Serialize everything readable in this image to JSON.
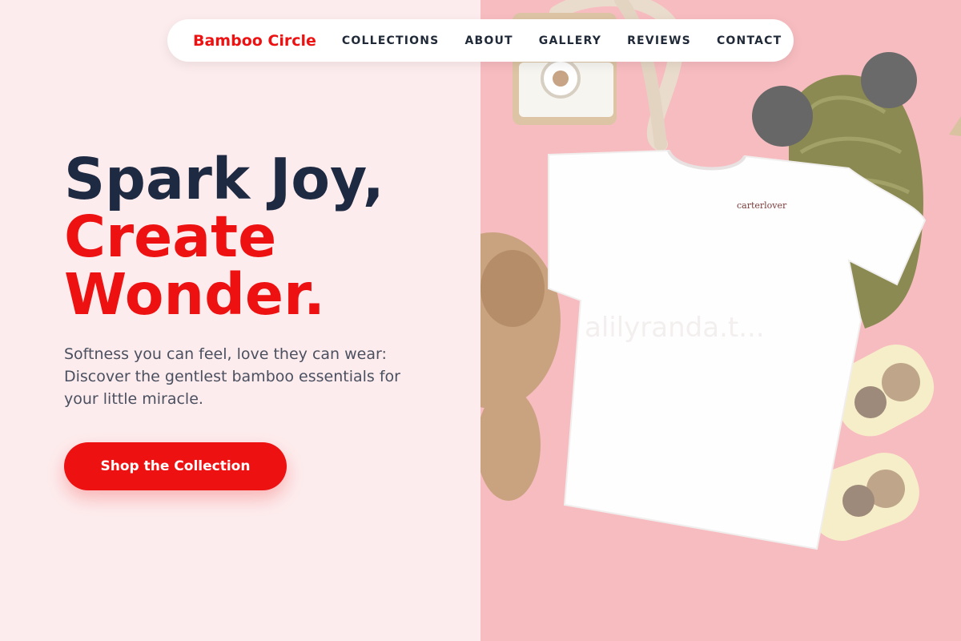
{
  "nav": {
    "brand": "Bamboo Circle",
    "links": [
      "COLLECTIONS",
      "ABOUT",
      "GALLERY",
      "REVIEWS",
      "CONTACT"
    ]
  },
  "hero": {
    "title_line1": "Spark Joy,",
    "title_line2": "Create",
    "title_line3": "Wonder.",
    "subtitle": "Softness you can feel, love they can wear: Discover the gentlest bamboo essentials for your little miracle.",
    "cta_label": "Shop the Collection"
  },
  "image": {
    "tshirt_label": "carterlover",
    "watermark": "alilyranda.t..."
  },
  "colors": {
    "accent": "#ee1111",
    "heading": "#1e2942",
    "left_background": "#fdeced",
    "right_background": "#f7bcc0"
  }
}
